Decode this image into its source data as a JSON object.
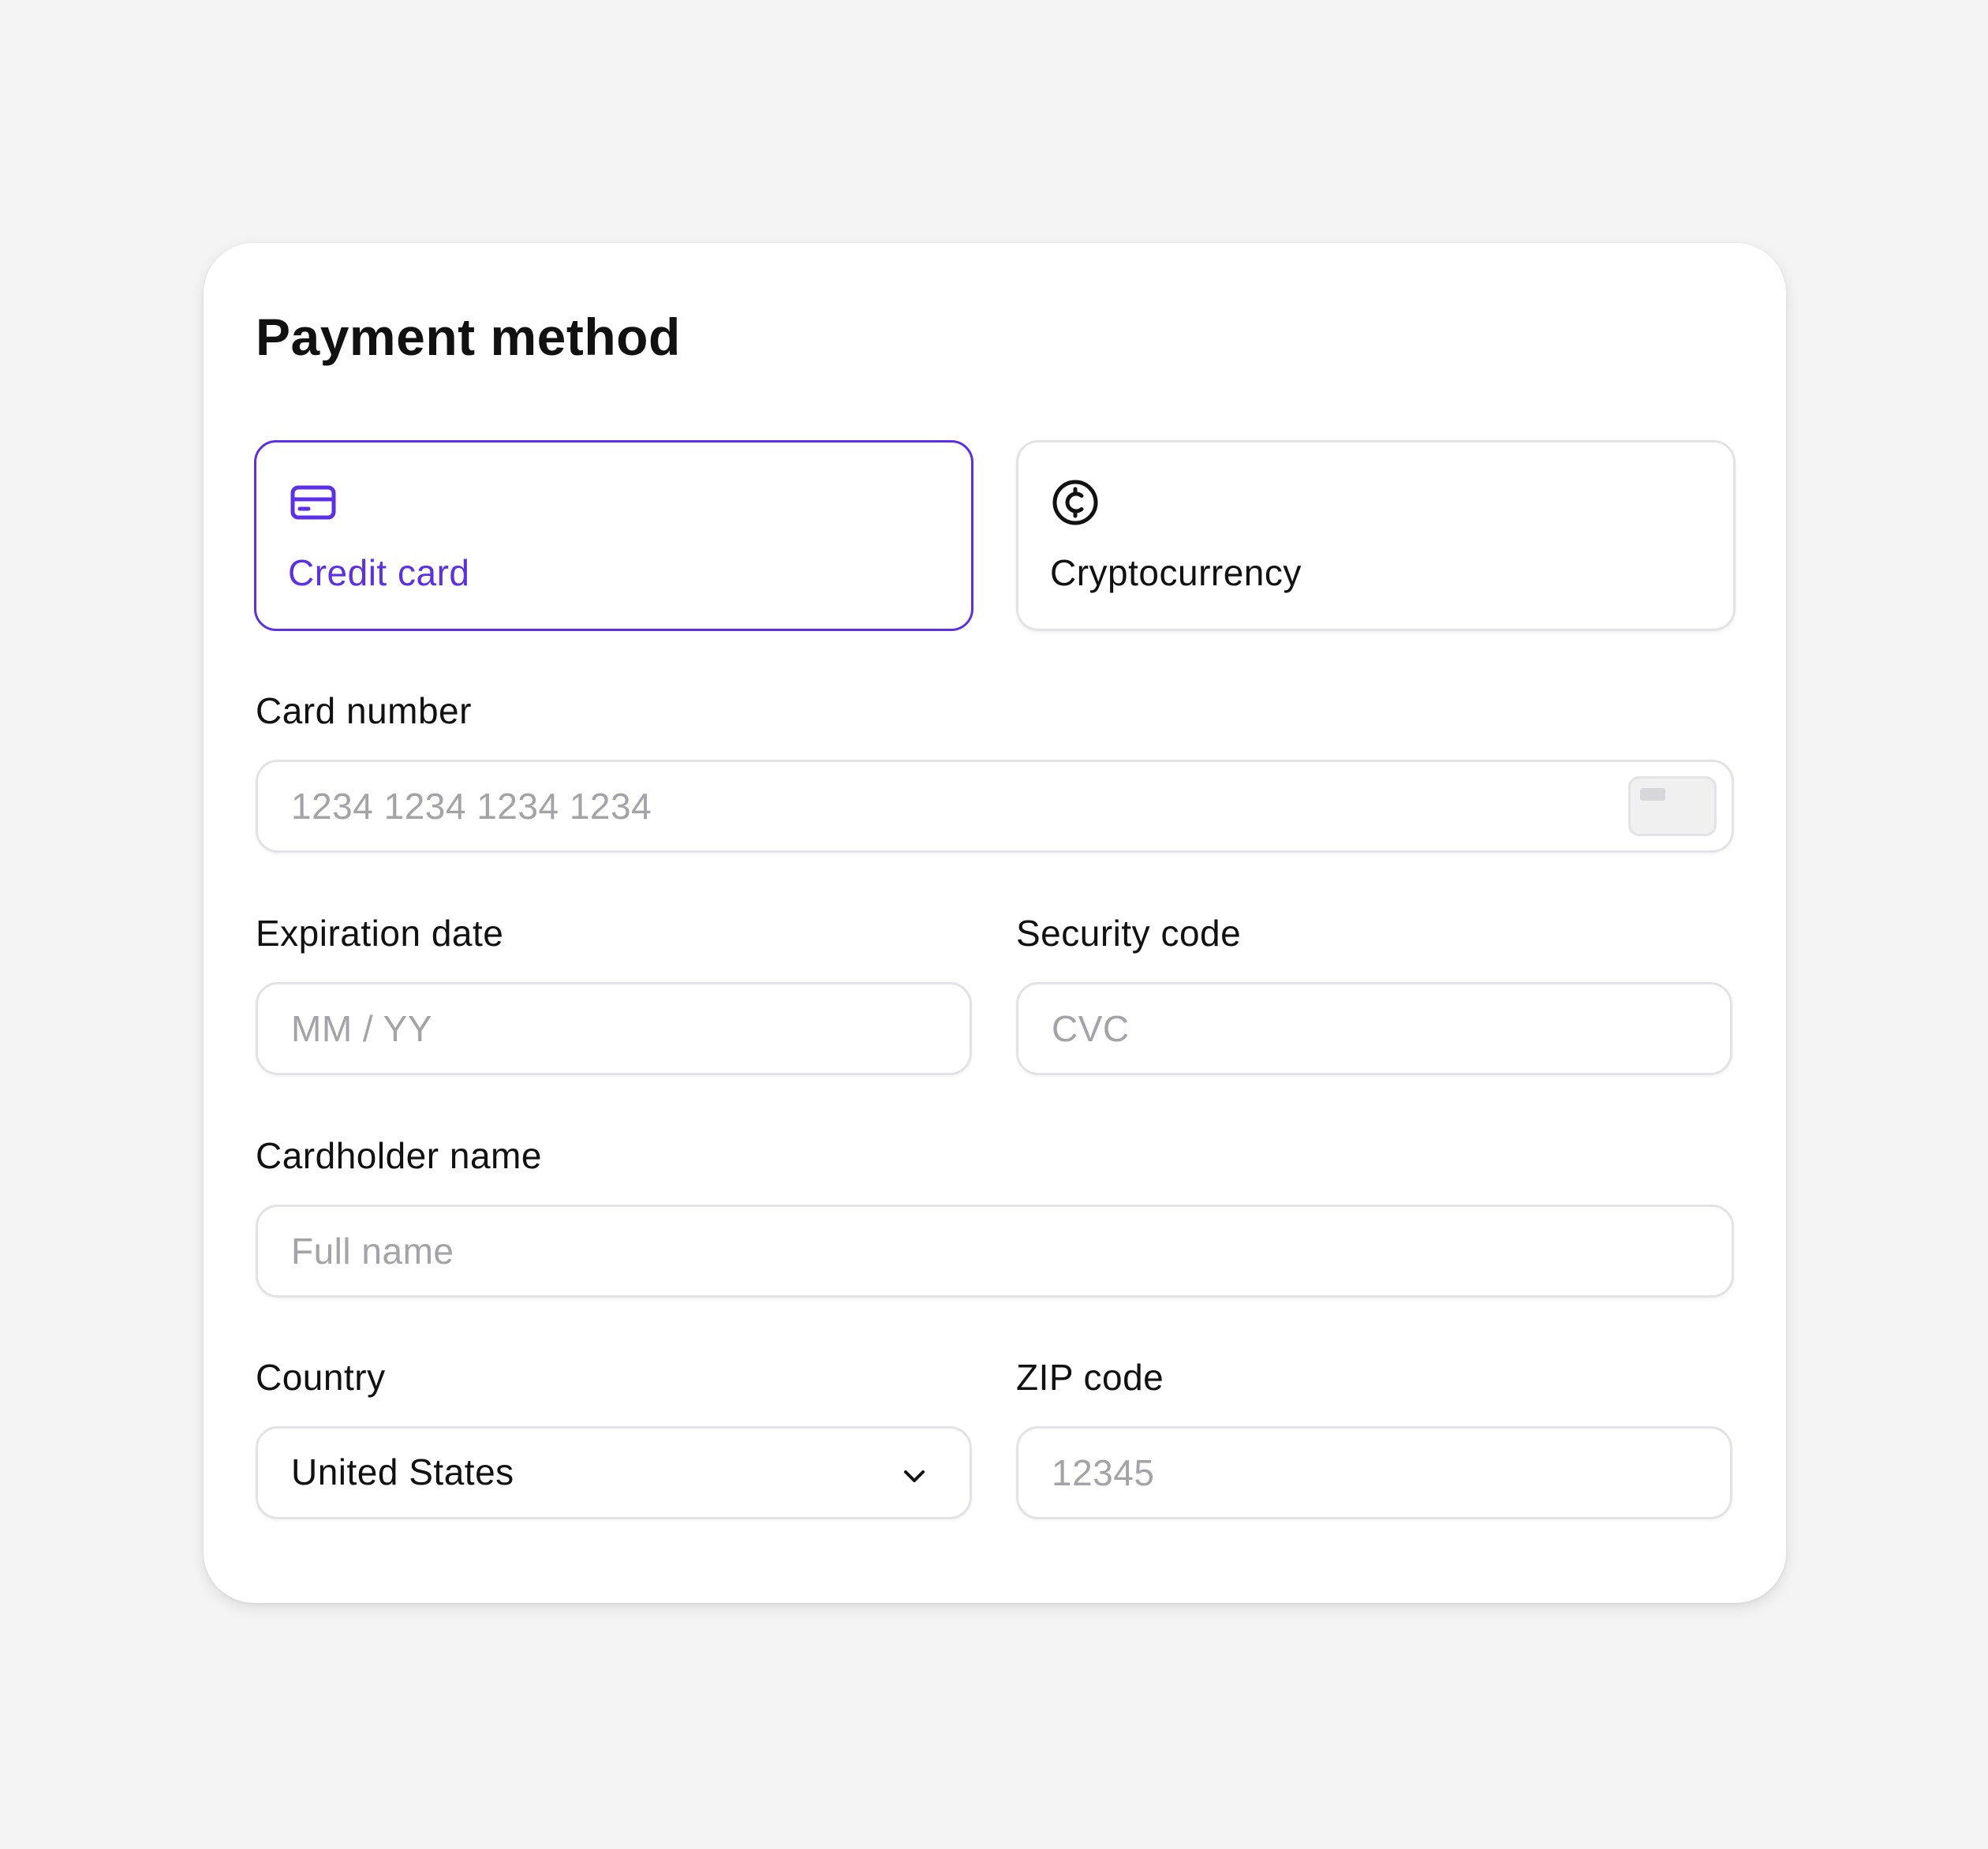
{
  "header": {
    "title": "Payment method"
  },
  "payment_options": [
    {
      "label": "Credit card",
      "icon": "credit-card-icon",
      "selected": true
    },
    {
      "label": "Cryptocurrency",
      "icon": "cent-coin-icon",
      "selected": false
    }
  ],
  "fields": {
    "card_number": {
      "label": "Card number",
      "placeholder": "1234 1234 1234 1234",
      "value": ""
    },
    "expiration": {
      "label": "Expiration date",
      "placeholder": "MM / YY",
      "value": ""
    },
    "security_code": {
      "label": "Security code",
      "placeholder": "CVC",
      "value": ""
    },
    "cardholder": {
      "label": "Cardholder name",
      "placeholder": "Full name",
      "value": ""
    },
    "country": {
      "label": "Country",
      "value": "United States"
    },
    "zip": {
      "label": "ZIP code",
      "placeholder": "12345",
      "value": ""
    }
  },
  "colors": {
    "accent": "#5b30e6",
    "background": "#f4f4f4",
    "card": "#ffffff",
    "border": "#e3e3e6",
    "placeholder": "#a3a3a8",
    "text": "#111111"
  }
}
